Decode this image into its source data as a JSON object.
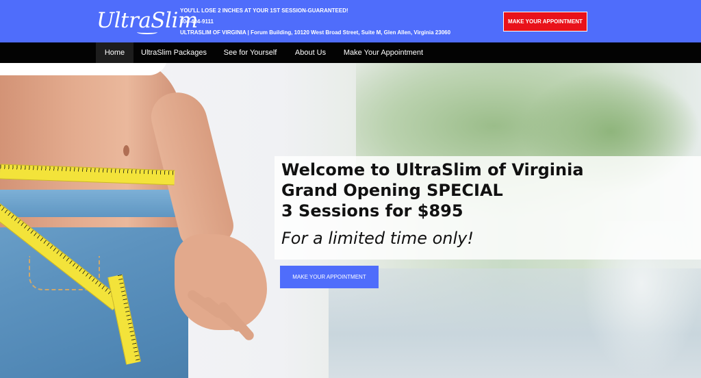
{
  "header": {
    "logo_text": "UltraSlim",
    "guarantee": "YOU'LL LOSE 2 INCHES AT YOUR 1ST SESSION-GUARANTEED!",
    "phone": "804-404-9111",
    "address": "ULTRASLIM OF VIRGINIA | Forum Building, 10120 West Broad Street, Suite M, Glen Allen, Virginia 23060",
    "cta": "MAKE YOUR APPOINTMENT",
    "colors": {
      "brand_blue": "#4f6dfb",
      "cta_red": "#e9121a"
    }
  },
  "nav": {
    "items": [
      {
        "label": "Home",
        "active": true
      },
      {
        "label": "UltraSlim Packages",
        "active": false
      },
      {
        "label": "See for Yourself",
        "active": false
      },
      {
        "label": "About Us",
        "active": false
      },
      {
        "label": "Make Your Appointment",
        "active": false
      }
    ]
  },
  "hero": {
    "line1": "Welcome to UltraSlim of Virginia",
    "line2": "Grand Opening SPECIAL",
    "line3": "3 Sessions for $895",
    "tagline": "For a limited time only!",
    "cta": "MAKE YOUR APPOINTMENT"
  }
}
